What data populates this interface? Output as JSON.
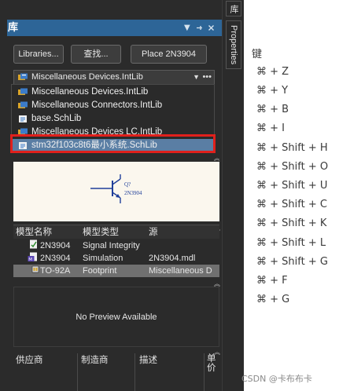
{
  "panel": {
    "title": "库",
    "buttons": {
      "libraries": "Libraries...",
      "search": "查找...",
      "place": "Place 2N3904"
    },
    "combo": {
      "value": "Miscellaneous Devices.IntLib",
      "caret": "▼",
      "dots": "•••"
    },
    "dropdown": [
      "Miscellaneous Devices.IntLib",
      "Miscellaneous Connectors.IntLib",
      "base.SchLib",
      "Miscellaneous Devices LC.IntLib",
      "stm32f103c8t6最小系统.SchLib"
    ],
    "preview": {
      "designator": "Q?",
      "part": "2N3904"
    },
    "models": {
      "headers": [
        "模型名称",
        "模型类型",
        "源"
      ],
      "rows": [
        {
          "name": "2N3904",
          "type": "Signal Integrity",
          "source": ""
        },
        {
          "name": "2N3904",
          "type": "Simulation",
          "source": "2N3904.mdl"
        },
        {
          "name": "TO-92A",
          "type": "Footprint",
          "source": "Miscellaneous D"
        }
      ]
    },
    "no_preview": "No Preview Available",
    "supplier": {
      "headers": [
        "供应商",
        "制造商",
        "描述",
        "单价"
      ]
    }
  },
  "side_tabs": {
    "library": "库",
    "properties": "Properties"
  },
  "shortcuts": {
    "header": "键",
    "items": [
      "⌘ + Z",
      "⌘ + Y",
      "⌘ + B",
      "⌘ + I",
      "⌘ + Shift + H",
      "⌘ + Shift + O",
      "⌘ + Shift + U",
      "⌘ + Shift + C",
      "⌘ + Shift + K",
      "⌘ + Shift + L",
      "⌘ + Shift + G",
      "⌘ + F",
      "⌘ + G"
    ]
  },
  "watermark": "CSDN @卡布布卡",
  "colors": {
    "panel_bg": "#2b2b2b",
    "titlebar": "#2d6597",
    "selection": "#5a7ea4",
    "highlight_box": "#e0201c",
    "preview_bg": "#fbf7ee"
  }
}
